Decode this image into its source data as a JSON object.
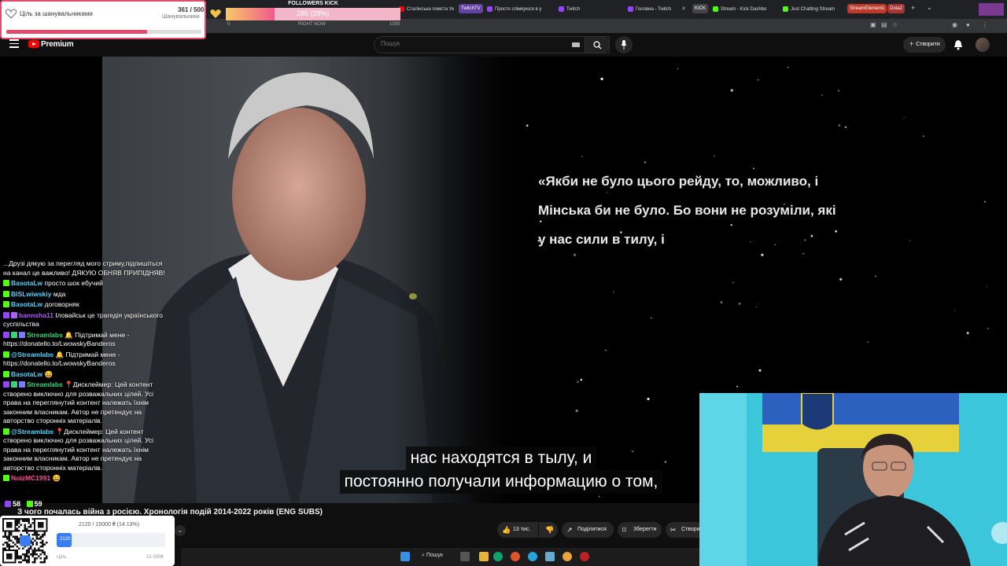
{
  "tabs": [
    {
      "title": "Сталінська помста Ук",
      "favicon": "youtube-icon"
    },
    {
      "title": "Просто спімкуюся в у",
      "favicon": "twitch-icon"
    },
    {
      "title": "Twitch",
      "favicon": "twitch-icon"
    },
    {
      "title": "Головна - Twitch",
      "favicon": "twitch-icon"
    },
    {
      "title": "Stream - Kick Dashbo",
      "favicon": "kick-icon"
    },
    {
      "title": "Just Chatting Stream",
      "favicon": "kick-icon"
    }
  ],
  "tab_pills": {
    "twitchtv": "TwitchTV",
    "kick": "KICK",
    "streamelements": "StreamElements",
    "dota": "Dota2"
  },
  "header": {
    "brand": "Premium",
    "search_placeholder": "Пошук",
    "create_label": "Створити"
  },
  "video": {
    "quote_lines": [
      "«Якби не було цього рейду, то, можливо, і",
      "Мінська би не було. Бо вони не розуміли, які",
      "у нас сили в тилу, і"
    ],
    "subtitles": [
      "нас находятся в тылу, и",
      "постоянно получали информацию о том,"
    ],
    "title": "З чого почалась війна з росією. Хронологія подій 2014-2022 років (ENG SUBS)"
  },
  "actions": {
    "likes": "13 тис.",
    "share": "Поділитися",
    "save": "Зберегти",
    "clip": "Створи"
  },
  "taskbar": {
    "search_label": "Пошук"
  },
  "goal_widget": {
    "label": "Ціль за шанувальниками",
    "count": "361 / 500",
    "sub": "Шанувальники",
    "progress": 0.72
  },
  "followers_widget": {
    "title": "FOLLOWERS KICK",
    "value": "285 (28%)",
    "progress": 0.28,
    "start": "0",
    "right_now": "RIGHT NOW",
    "end": "1000"
  },
  "chat": [
    {
      "parts": [
        {
          "t": "...Друзі дякую за перегляд мого стриму,підпишіться на канал це важливо! ДЯКУЮ ОБНЯВ ПРИПІДНЯВ!",
          "c": "#ffffff"
        }
      ],
      "badges": []
    },
    {
      "user": "BasotaLw",
      "color": "#53d4ff",
      "text": "просто шок ебучий",
      "badges": [
        "kick"
      ]
    },
    {
      "user": "BISLwiwskiy",
      "color": "#53d4ff",
      "text": "мда",
      "badges": [
        "kick"
      ]
    },
    {
      "user": "BasotaLw",
      "color": "#53d4ff",
      "text": "договорняк",
      "badges": [
        "kick"
      ]
    },
    {
      "user": "bannsha11",
      "color": "#b05cff",
      "text": "Іловайськ це трагедія українського суспільства",
      "badges": [
        "twitch",
        "star"
      ]
    },
    {
      "user": "Streamlabs",
      "color": "#3ad37a",
      "text": "🔔 Підтримай мене - https://donatello.to/LwowskyBanderos",
      "badges": [
        "twitch",
        "check",
        "sl"
      ]
    },
    {
      "user": "@Streamlabs",
      "color": "#53d4ff",
      "text": "🔔 Підтримай мене - https://donatello.to/LwowskyBanderos",
      "badges": [
        "kick"
      ]
    },
    {
      "user": "BasotaLw",
      "color": "#53d4ff",
      "text": "😄",
      "badges": [
        "kick"
      ]
    },
    {
      "user": "Streamlabs",
      "color": "#3ad37a",
      "text": "📍Дисклеймер: Цей контент створено виключно для розважальних цілей. Усі права на переглянутий контент належать їхнім законним власникам. Автор не претендує на авторство сторонніх матеріалів.",
      "badges": [
        "twitch",
        "check",
        "sl"
      ]
    },
    {
      "user": "@Streamlabs",
      "color": "#53d4ff",
      "text": "📍Дисклеймер: Цей контент створено виключно для розважальних цілей. Усі права на переглянутий контент належать їхнім законним власникам. Автор не претендує на авторство сторонніх матеріалів.",
      "badges": [
        "kick"
      ]
    },
    {
      "user": "NoizMC1991",
      "color": "#ff4f9a",
      "text": "😄",
      "badges": [
        "kick"
      ]
    }
  ],
  "counters": {
    "twitch": "58",
    "kick": "59"
  },
  "donation_widget": {
    "amount": "2120 / 15000 ₴ (14.13%)",
    "bar_value": "2120",
    "progress": 0.1413,
    "left_label": "Ціль",
    "right_label": "15 000₴"
  },
  "colors": {
    "accent": "#ff0000",
    "chat_pink": "#e24b6c",
    "kick": "#53fc18"
  }
}
